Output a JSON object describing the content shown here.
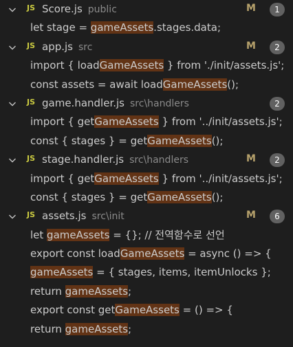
{
  "files": [
    {
      "name": "Score.js",
      "path": "public",
      "status": "M",
      "count": "1",
      "matches": [
        [
          [
            "let stage = ",
            false
          ],
          [
            "gameAssets",
            true
          ],
          [
            ".stages.data;",
            false
          ]
        ]
      ]
    },
    {
      "name": "app.js",
      "path": "src",
      "status": "M",
      "count": "2",
      "matches": [
        [
          [
            "import { load",
            false
          ],
          [
            "GameAssets",
            true
          ],
          [
            " } from './init/assets.js';",
            false
          ]
        ],
        [
          [
            "const assets = await load",
            false
          ],
          [
            "GameAssets",
            true
          ],
          [
            "();",
            false
          ]
        ]
      ]
    },
    {
      "name": "game.handler.js",
      "path": "src\\handlers",
      "status": "",
      "count": "2",
      "matches": [
        [
          [
            "import { get",
            false
          ],
          [
            "GameAssets",
            true
          ],
          [
            " } from '../init/assets.js';",
            false
          ]
        ],
        [
          [
            "const { stages } = get",
            false
          ],
          [
            "GameAssets",
            true
          ],
          [
            "();",
            false
          ]
        ]
      ]
    },
    {
      "name": "stage.handler.js",
      "path": "src\\handlers",
      "status": "M",
      "count": "2",
      "matches": [
        [
          [
            "import { get",
            false
          ],
          [
            "GameAssets",
            true
          ],
          [
            " } from '../init/assets.js';",
            false
          ]
        ],
        [
          [
            "const { stages } = get",
            false
          ],
          [
            "GameAssets",
            true
          ],
          [
            "();",
            false
          ]
        ]
      ]
    },
    {
      "name": "assets.js",
      "path": "src\\init",
      "status": "M",
      "count": "6",
      "matches": [
        [
          [
            "let ",
            false
          ],
          [
            "gameAssets",
            true
          ],
          [
            " = {}; // 전역함수로 선언",
            false
          ]
        ],
        [
          [
            "export const load",
            false
          ],
          [
            "GameAssets",
            true
          ],
          [
            " = async () => {",
            false
          ]
        ],
        [
          [
            "gameAssets",
            true
          ],
          [
            " = { stages, items, itemUnlocks };",
            false
          ]
        ],
        [
          [
            "return ",
            false
          ],
          [
            "gameAssets",
            true
          ],
          [
            ";",
            false
          ]
        ],
        [
          [
            "export const get",
            false
          ],
          [
            "GameAssets",
            true
          ],
          [
            " = () => {",
            false
          ]
        ],
        [
          [
            "return ",
            false
          ],
          [
            "gameAssets",
            true
          ],
          [
            ";",
            false
          ]
        ]
      ]
    }
  ],
  "icons": {
    "file_type": "JS",
    "chevron": "chevron-down-icon"
  },
  "colors": {
    "highlight": "#623315",
    "js_icon": "#cbcb41",
    "modified": "#b7a26c",
    "badge_bg": "#616161"
  }
}
